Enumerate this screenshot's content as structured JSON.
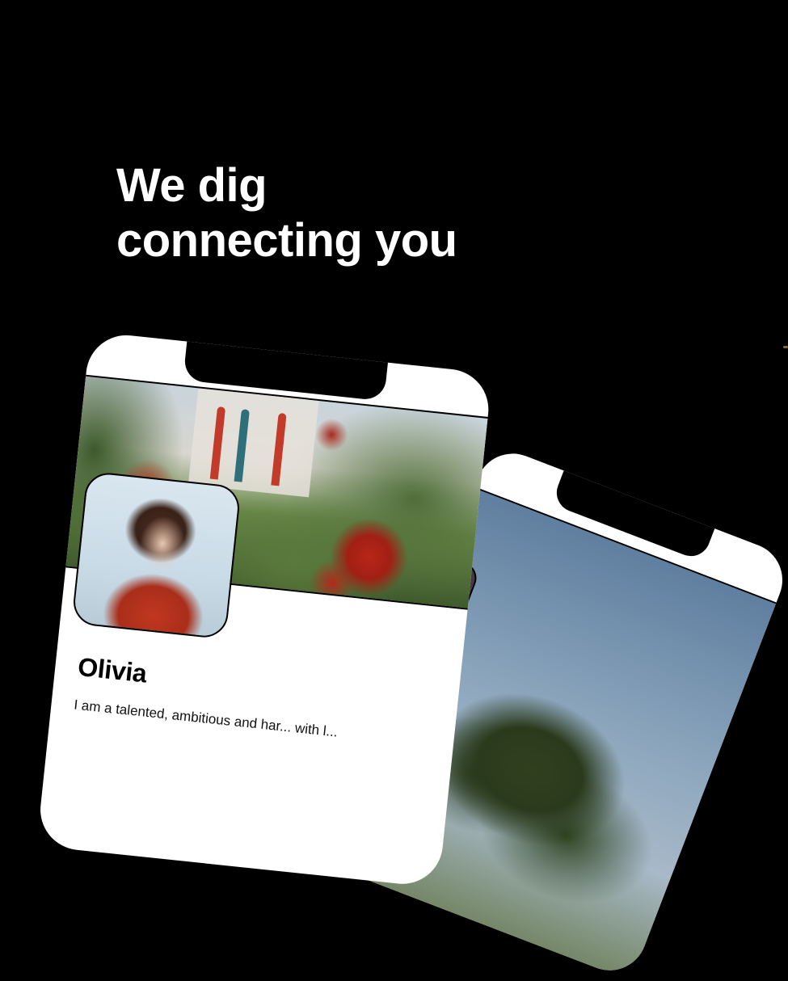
{
  "hero": {
    "line1": "We dig",
    "line2": "connecting you"
  },
  "profile_card": {
    "name": "Olivia",
    "bio": "I am a talented, ambitious and har... with l..."
  },
  "colors": {
    "background": "#000000",
    "headline_text": "#ffffff",
    "card_background": "#ffffff",
    "outline": "#000000"
  }
}
